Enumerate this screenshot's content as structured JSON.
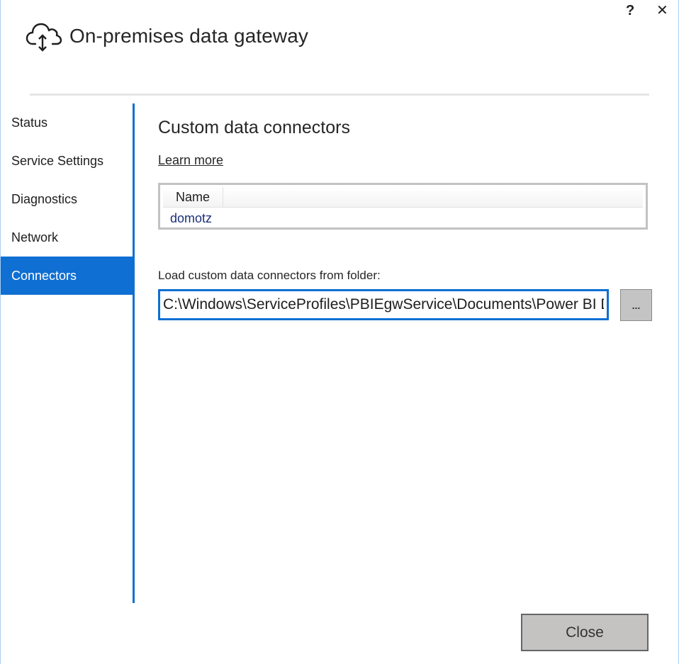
{
  "window": {
    "title": "On-premises data gateway",
    "app_icon": "cloud-upload-download-icon",
    "help_label": "?",
    "close_label": "✕"
  },
  "sidebar": {
    "items": [
      {
        "label": "Status",
        "active": false
      },
      {
        "label": "Service Settings",
        "active": false
      },
      {
        "label": "Diagnostics",
        "active": false
      },
      {
        "label": "Network",
        "active": false
      },
      {
        "label": "Connectors",
        "active": true
      }
    ]
  },
  "main": {
    "title": "Custom data connectors",
    "learn_more": "Learn more",
    "connectors_list": {
      "columns": [
        "Name"
      ],
      "rows": [
        {
          "name": "domotz"
        }
      ]
    },
    "folder_label": "Load custom data connectors from folder:",
    "folder_path": "C:\\Windows\\ServiceProfiles\\PBIEgwService\\Documents\\Power BI Desktop\\Custom Connectors",
    "browse_label": "..."
  },
  "footer": {
    "close_button": "Close"
  },
  "colors": {
    "accent": "#0f6fd2",
    "button_bg": "#c4c3c2",
    "link_row": "#1a2f7a"
  }
}
